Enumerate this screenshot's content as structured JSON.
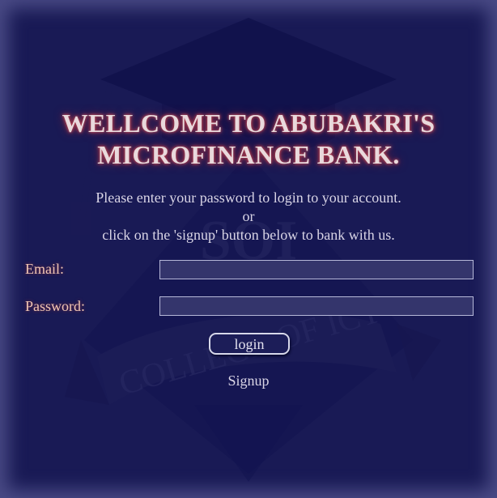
{
  "page": {
    "background": "#191a55",
    "accent_glow": "#b03a4a"
  },
  "header": {
    "title_line1": "WELLCOME TO ABUBAKRI'S",
    "title_line2": "MICROFINANCE BANK."
  },
  "intro": {
    "line1": "Please enter your password to login to your account.",
    "line2": "or",
    "line3": "click on the 'signup' button below to bank with us."
  },
  "form": {
    "email_label": "Email:",
    "email_value": "",
    "password_label": "Password:",
    "password_value": "",
    "login_label": "login",
    "signup_label": "Signup"
  },
  "watermark": {
    "emblem_text": "SOI",
    "banner_text": "COLLEGE OF ICT",
    "icon": "graduation-cap-logo"
  }
}
